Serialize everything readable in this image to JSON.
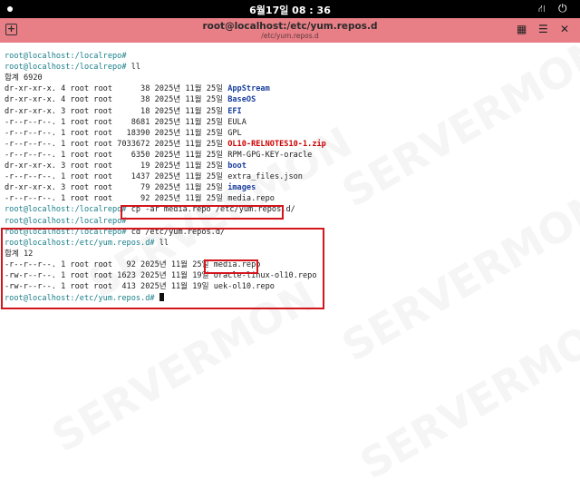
{
  "system_bar": {
    "clock": "6월17일 08 : 36",
    "network_icon": "network-icon",
    "power_icon": "power-icon"
  },
  "window": {
    "title": "root@localhost:/etc/yum.repos.d",
    "subtitle": "/etc/yum.repos.d",
    "new_tab_icon": "new-tab-icon",
    "grid_icon": "grid-icon",
    "menu_icon": "hamburger-menu-icon",
    "close_icon": "close-icon",
    "accent_color": "#e87f86"
  },
  "terminal": {
    "lines": [
      {
        "prompt": "root@localhost:/localrepo#",
        "text": ""
      },
      {
        "prompt": "root@localhost:/localrepo#",
        "text": " ll"
      },
      {
        "text": "합계 6920"
      },
      {
        "perm": "dr-xr-xr-x. 4 root root      38 2025년 11월 25일 ",
        "name": "AppStream",
        "kind": "dir"
      },
      {
        "perm": "dr-xr-xr-x. 4 root root      38 2025년 11월 25일 ",
        "name": "BaseOS",
        "kind": "dir"
      },
      {
        "perm": "dr-xr-xr-x. 3 root root      18 2025년 11월 25일 ",
        "name": "EFI",
        "kind": "dir"
      },
      {
        "perm": "-r--r--r--. 1 root root    8681 2025년 11월 25일 ",
        "name": "EULA",
        "kind": "file"
      },
      {
        "perm": "-r--r--r--. 1 root root   18390 2025년 11월 25일 ",
        "name": "GPL",
        "kind": "file"
      },
      {
        "perm": "-r--r--r--. 1 root root 7033672 2025년 11월 25일 ",
        "name": "OL10-RELNOTES10-1.zip",
        "kind": "zip"
      },
      {
        "perm": "-r--r--r--. 1 root root    6350 2025년 11월 25일 ",
        "name": "RPM-GPG-KEY-oracle",
        "kind": "file"
      },
      {
        "perm": "dr-xr-xr-x. 3 root root      19 2025년 11월 25일 ",
        "name": "boot",
        "kind": "dir"
      },
      {
        "perm": "-r--r--r--. 1 root root    1437 2025년 11월 25일 ",
        "name": "extra_files.json",
        "kind": "file"
      },
      {
        "perm": "dr-xr-xr-x. 3 root root      79 2025년 11월 25일 ",
        "name": "images",
        "kind": "dir"
      },
      {
        "perm": "-r--r--r--. 1 root root      92 2025년 11월 25일 ",
        "name": "media.repo",
        "kind": "file"
      },
      {
        "prompt": "root@localhost:/localrepo#",
        "text": " cp -ar media.repo /etc/yum.repos.d/"
      },
      {
        "prompt": "root@localhost:/localrepo#",
        "text": ""
      },
      {
        "prompt": "root@localhost:/localrepo#",
        "text": " cd /etc/yum.repos.d/"
      },
      {
        "prompt": "root@localhost:/etc/yum.repos.d#",
        "text": " ll"
      },
      {
        "text": "합계 12"
      },
      {
        "perm": "-r--r--r--. 1 root root   92 2025년 11월 25일 ",
        "name": "media.repo",
        "kind": "file"
      },
      {
        "perm": "-rw-r--r--. 1 root root 1623 2025년 11월 19일 ",
        "name": "oracle-linux-ol10.repo",
        "kind": "file"
      },
      {
        "perm": "-rw-r--r--. 1 root root  413 2025년 11월 19일 ",
        "name": "uek-ol10.repo",
        "kind": "file"
      },
      {
        "prompt": "root@localhost:/etc/yum.repos.d#",
        "text": " ",
        "cursor": true
      }
    ]
  },
  "watermark": "SERVERMON",
  "colors": {
    "prompt": "#1a7f8a",
    "directory": "#1a3f9e",
    "archive": "#cc0000",
    "highlight": "#d3161c"
  }
}
